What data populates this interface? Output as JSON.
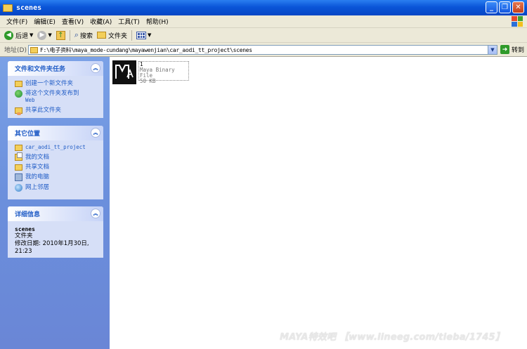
{
  "window": {
    "title": "scenes",
    "buttons": [
      "minimize",
      "maximize",
      "close"
    ]
  },
  "menubar": {
    "items": [
      "文件(F)",
      "编辑(E)",
      "查看(V)",
      "收藏(A)",
      "工具(T)",
      "帮助(H)"
    ]
  },
  "toolbar": {
    "back_label": "后退",
    "search_label": "搜索",
    "folders_label": "文件夹"
  },
  "address": {
    "label": "地址(D)",
    "path": "F:\\电子资料\\maya_mode-cundang\\mayawenjian\\car_aodi_tt_project\\scenes",
    "go_label": "转到"
  },
  "tasks_panel": {
    "title": "文件和文件夹任务",
    "items": [
      {
        "label": "创建一个新文件夹",
        "icon": "new-folder-icon"
      },
      {
        "label": "将这个文件夹发布到",
        "label2": "Web",
        "icon": "web-publish-icon"
      },
      {
        "label": "共享此文件夹",
        "icon": "share-folder-icon"
      }
    ]
  },
  "other_places": {
    "title": "其它位置",
    "items": [
      {
        "label": "car_aodi_tt_project",
        "icon": "folder-icon"
      },
      {
        "label": "我的文档",
        "icon": "my-documents-icon"
      },
      {
        "label": "共享文档",
        "icon": "shared-documents-icon"
      },
      {
        "label": "我的电脑",
        "icon": "my-computer-icon"
      },
      {
        "label": "网上邻居",
        "icon": "network-places-icon"
      }
    ]
  },
  "details_panel": {
    "title": "详细信息",
    "name": "scenes",
    "type": "文件夹",
    "modified_line1": "修改日期: 2010年1月30日,",
    "modified_line2": "21:23"
  },
  "files": [
    {
      "name": "1",
      "type": "Maya Binary File",
      "size": "50 KB",
      "icon": "maya-file-icon"
    }
  ],
  "watermark": "MAYA特效吧 【www.lineeg.com/tieba/1745】",
  "colors": {
    "titlebar": "#0a55d8",
    "sidebar": "#6b8fdc",
    "panel": "#d6dff7",
    "link": "#215dc6"
  }
}
